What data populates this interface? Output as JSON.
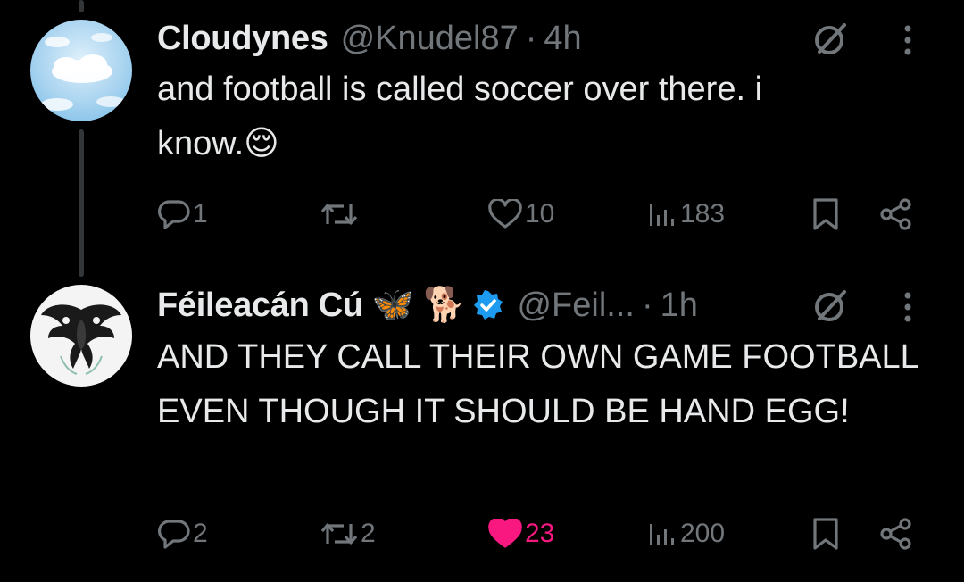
{
  "tweets": [
    {
      "name": "Cloudynes",
      "handle": "@Knudel87",
      "separator": "·",
      "time": "4h",
      "text_line1": "and football is called soccer over there. i",
      "text_line2": "know.",
      "text_emoji": "😌",
      "replies": "1",
      "retweets": "",
      "likes": "10",
      "views": "183",
      "liked": false
    },
    {
      "name": "Féileacán Cú",
      "name_emoji_1": "🦋",
      "name_emoji_2": "🐕",
      "handle": "@Feil...",
      "separator": "·",
      "time": "1h",
      "text": "AND THEY CALL THEIR OWN GAME FOOTBALL EVEN THOUGH IT SHOULD BE HAND EGG!",
      "replies": "2",
      "retweets": "2",
      "likes": "23",
      "views": "200",
      "liked": true
    }
  ],
  "colors": {
    "background": "#000000",
    "text": "#e7e9ea",
    "muted": "#71767b",
    "like_active": "#f91880",
    "verified": "#1d9bf0"
  },
  "icons": {
    "reply": "reply-icon",
    "retweet": "retweet-icon",
    "like": "heart-icon",
    "views": "views-icon",
    "bookmark": "bookmark-icon",
    "share": "share-icon",
    "grok": "grok-icon",
    "more": "more-icon"
  }
}
